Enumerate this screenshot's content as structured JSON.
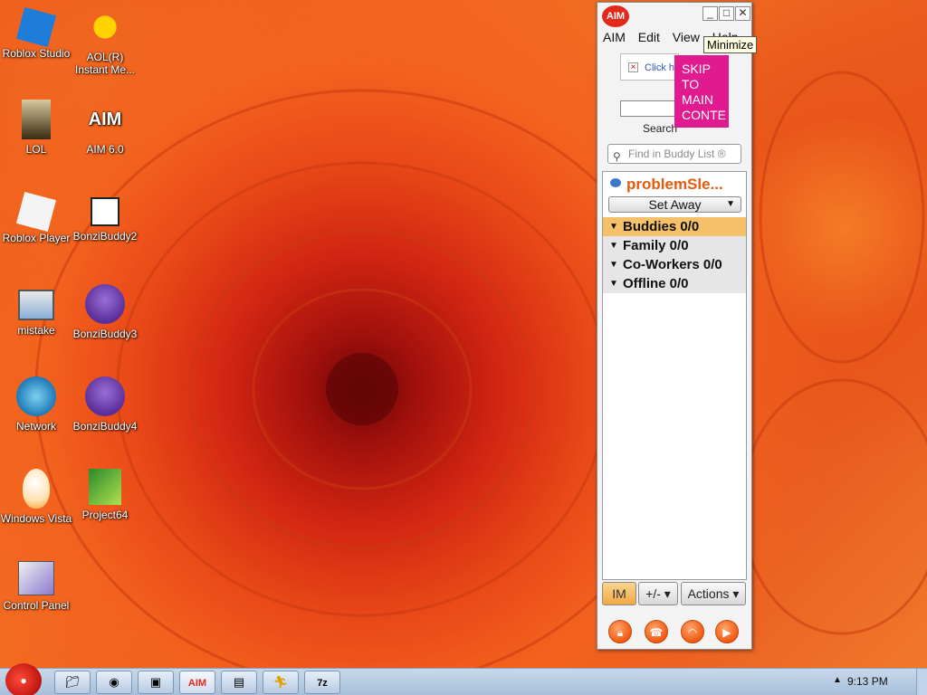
{
  "desktop": {
    "icons": [
      {
        "label": "Roblox Studio",
        "icon": "roblox-studio-icon"
      },
      {
        "label": "AOL(R) Instant Me...",
        "icon": "aol-running-man-icon"
      },
      {
        "label": "LOL",
        "icon": "lol-icon"
      },
      {
        "label": "AIM 6.0",
        "icon": "aim-icon"
      },
      {
        "label": "Roblox Player",
        "icon": "roblox-player-icon"
      },
      {
        "label": "BonziBuddy2",
        "icon": "movie-file-icon"
      },
      {
        "label": "mistake",
        "icon": "computer-icon"
      },
      {
        "label": "BonziBuddy3",
        "icon": "bonzi-purple-gorilla-icon"
      },
      {
        "label": "Network",
        "icon": "network-globe-icon"
      },
      {
        "label": "BonziBuddy4",
        "icon": "bonzi-purple-gorilla-icon"
      },
      {
        "label": "Windows Vista",
        "icon": "egg-icon"
      },
      {
        "label": "Project64",
        "icon": "project64-icon"
      },
      {
        "label": "Control Panel",
        "icon": "control-panel-icon"
      }
    ]
  },
  "aim_window": {
    "logo": "AIM",
    "menu": [
      "AIM",
      "Edit",
      "View",
      "Help"
    ],
    "tooltip": "Minimize",
    "ad_text": "Click h",
    "ad_search": "Search",
    "skip_link": "SKIP TO MAIN CONTE",
    "find_placeholder": "Find in Buddy List ®",
    "screen_name": "problemSle...",
    "status": "Set Away",
    "groups": [
      {
        "label": "Buddies 0/0",
        "selected": true
      },
      {
        "label": "Family 0/0",
        "selected": false
      },
      {
        "label": "Co-Workers 0/0",
        "selected": false
      },
      {
        "label": "Offline 0/0",
        "selected": false
      }
    ],
    "bottom_buttons": {
      "im": "IM",
      "addremove": "+/-",
      "actions": "Actions"
    },
    "tools": [
      "lock-icon",
      "phone-icon",
      "headphones-icon",
      "play-icon"
    ]
  },
  "taskbar": {
    "clock": "9:13 PM",
    "buttons": [
      "explorer-icon",
      "chrome-icon",
      "monitor-icon",
      "aim-icon",
      "explorer-icon",
      "aol-running-man-icon",
      "7zip-icon"
    ],
    "accent_color": "#e55a0c"
  }
}
